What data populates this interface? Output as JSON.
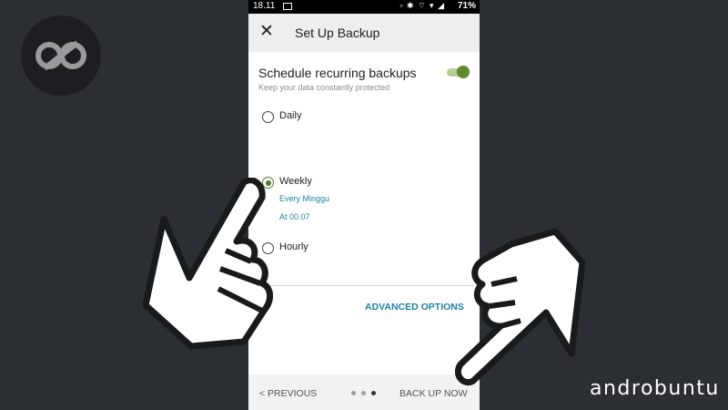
{
  "status_bar": {
    "time": "18.11",
    "battery": "71%",
    "icons": "▫ ✱ ⌔ ▾ ◢"
  },
  "app_bar": {
    "close_icon": "close-icon",
    "title": "Set Up Backup"
  },
  "schedule": {
    "title": "Schedule recurring backups",
    "subtitle": "Keep your data constantly protected",
    "enabled": true
  },
  "frequency_options": [
    {
      "label": "Daily",
      "selected": false
    },
    {
      "label": "Weekly",
      "selected": true,
      "detail_day": "Every Minggu",
      "detail_time": "At 00.07"
    },
    {
      "label": "Hourly",
      "selected": false
    }
  ],
  "advanced_options_label": "ADVANCED OPTIONS",
  "footer": {
    "previous_label": "< PREVIOUS",
    "next_label": "BACK UP NOW",
    "page_count": 3,
    "current_page": 3
  },
  "brand": "androbuntu",
  "colors": {
    "background": "#2b2e33",
    "accent_green": "#5f8a2b",
    "link_blue": "#1f7fa3",
    "app_bar": "#eeeeee"
  }
}
